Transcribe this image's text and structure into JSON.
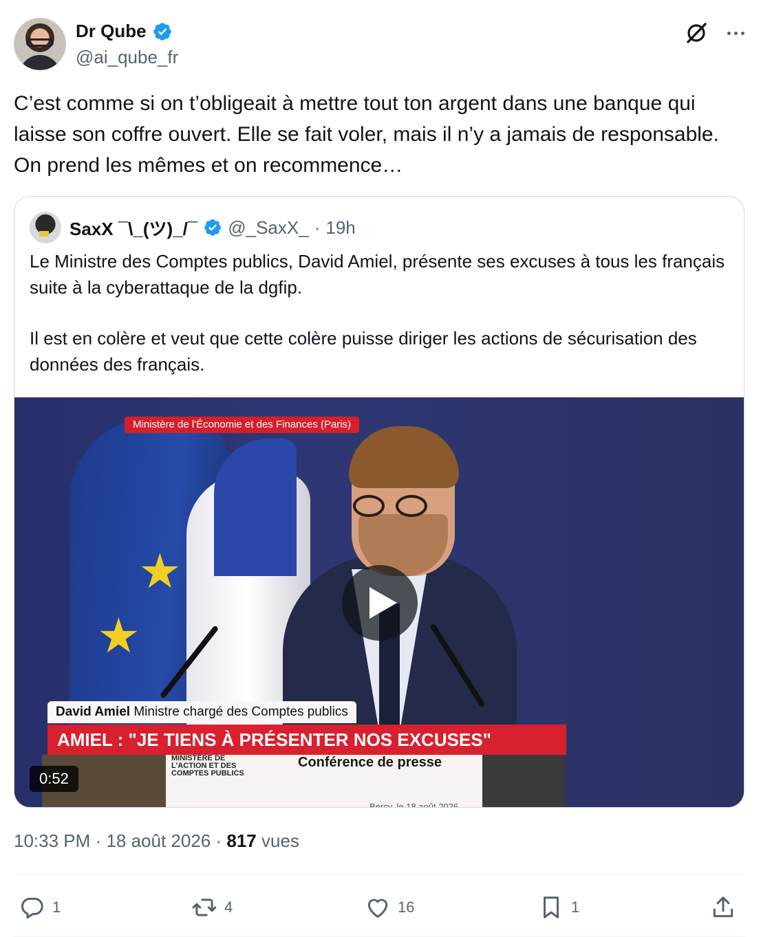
{
  "author": {
    "display_name": "Dr Qube",
    "handle": "@ai_qube_fr",
    "verified": true
  },
  "icons": {
    "verified": "verified-badge-icon",
    "grok": "grok-icon",
    "more": "more-icon",
    "reply": "reply-icon",
    "retweet": "retweet-icon",
    "like": "heart-icon",
    "bookmark": "bookmark-icon",
    "share": "share-icon",
    "play": "play-icon"
  },
  "colors": {
    "verified_blue": "#1d9bf0",
    "text_primary": "#0f1419",
    "text_secondary": "#536471",
    "border": "#cfd9de",
    "news_red": "#d8202f"
  },
  "tweet": {
    "text": "C’est comme si on t’obligeait à mettre tout ton argent dans une banque qui laisse son coffre ouvert. Elle se fait voler, mais il n’y a jamais de responsable. On prend les mêmes et on recommence…"
  },
  "quote": {
    "display_name": "SaxX ¯\\_(ツ)_/¯",
    "handle": "@_SaxX_",
    "separator": "·",
    "time": "19h",
    "paragraph1": "Le Ministre des Comptes publics, David Amiel, présente ses excuses à tous les français suite à la cyberattaque de la dgfip.",
    "paragraph2": "Il est en colère et veut que cette colère puisse diriger les actions de sécurisation des données des français.",
    "video": {
      "location_banner": "Ministère de l'Économie et des Finances (Paris)",
      "speaker_name": "David Amiel",
      "speaker_title": "Ministre chargé des Comptes publics",
      "headline": "AMIEL : \"JE TIENS À PRÉSENTER NOS EXCUSES\"",
      "podium_ministry": "MINISTÈRE DE L'ACTION ET DES COMPTES PUBLICS",
      "podium_title": "Conférence de presse",
      "podium_date": "Bercy, le 18 août 2026",
      "duration": "0:52"
    }
  },
  "meta": {
    "time": "10:33 PM",
    "sep1": "·",
    "date": "18 août 2026",
    "sep2": "·",
    "views_count": "817",
    "views_label": "vues"
  },
  "actions": {
    "replies": "1",
    "reposts": "4",
    "likes": "16",
    "bookmarks": "1"
  }
}
